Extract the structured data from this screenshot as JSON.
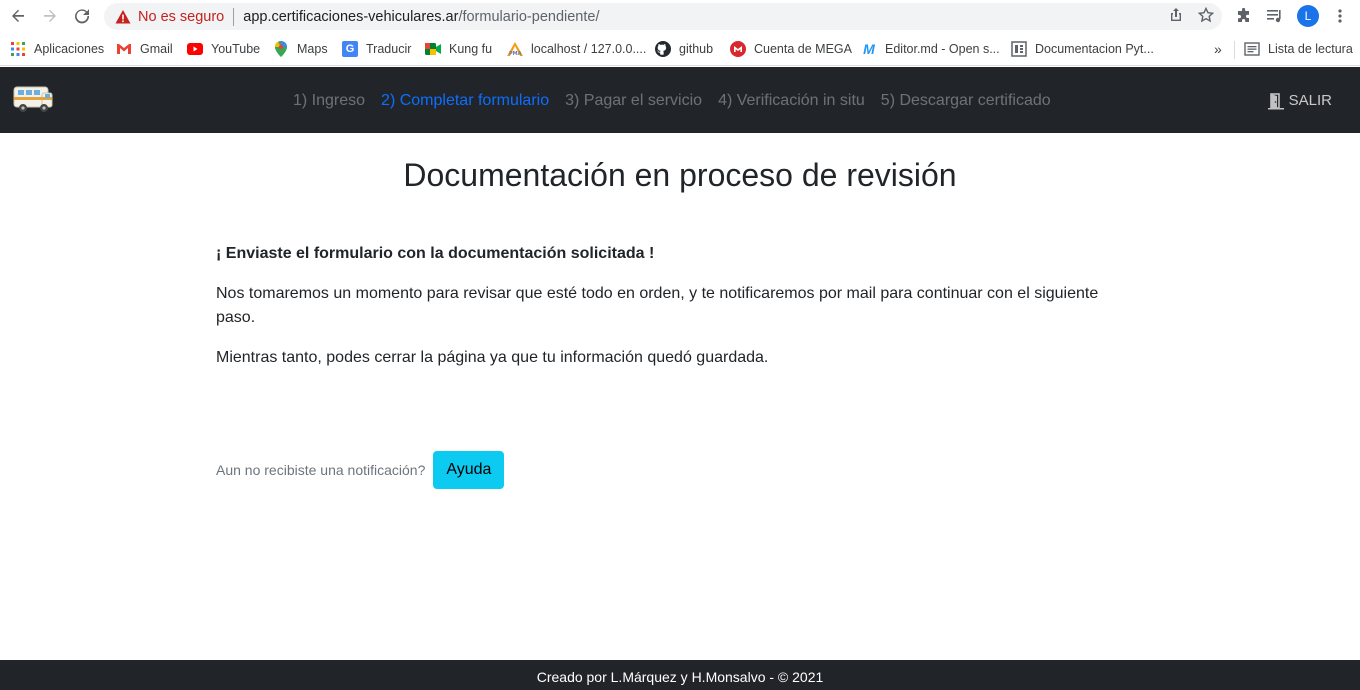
{
  "browser": {
    "not_secure_label": "No es seguro",
    "url_host": "app.certificaciones-vehiculares.ar",
    "url_path": "/formulario-pendiente/",
    "profile_initial": "L"
  },
  "bookmarks": {
    "items": [
      {
        "label": "Aplicaciones",
        "icon": "apps-grid-icon"
      },
      {
        "label": "Gmail",
        "icon": "gmail-icon"
      },
      {
        "label": "YouTube",
        "icon": "youtube-icon"
      },
      {
        "label": "Maps",
        "icon": "maps-pin-icon"
      },
      {
        "label": "Traducir",
        "icon": "translate-icon"
      },
      {
        "label": "Kung fu",
        "icon": "meet-icon"
      },
      {
        "label": "localhost / 127.0.0....",
        "icon": "phpmyadmin-icon"
      },
      {
        "label": "github",
        "icon": "github-icon"
      },
      {
        "label": "Cuenta de MEGA",
        "icon": "mega-icon"
      },
      {
        "label": "Editor.md - Open s...",
        "icon": "editor-md-icon"
      },
      {
        "label": "Documentacion Pyt...",
        "icon": "document-icon"
      }
    ],
    "overflow": "»",
    "reading_list": "Lista de lectura"
  },
  "navbar": {
    "steps": [
      {
        "label": "1) Ingreso",
        "active": false
      },
      {
        "label": "2) Completar formulario",
        "active": true
      },
      {
        "label": "3) Pagar el servicio",
        "active": false
      },
      {
        "label": "4) Verificación in situ",
        "active": false
      },
      {
        "label": "5) Descargar certificado",
        "active": false
      }
    ],
    "logout_label": "SALIR"
  },
  "main": {
    "title": "Documentación en proceso de revisión",
    "confirmation": "¡ Enviaste el formulario con la documentación solicitada !",
    "paragraph1": "Nos tomaremos un momento para revisar que esté todo en orden, y te notificaremos por mail para continuar con el siguiente paso.",
    "paragraph2": "Mientras tanto, podes cerrar la página ya que tu información quedó guardada.",
    "help_prompt": "Aun no recibiste una notificación?",
    "help_button": "Ayuda"
  },
  "footer": {
    "text": "Creado por L.Márquez y H.Monsalvo - © 2021"
  },
  "colors": {
    "navbar_bg": "#212529",
    "active_step": "#0d6efd",
    "help_button": "#0dcaf0"
  }
}
